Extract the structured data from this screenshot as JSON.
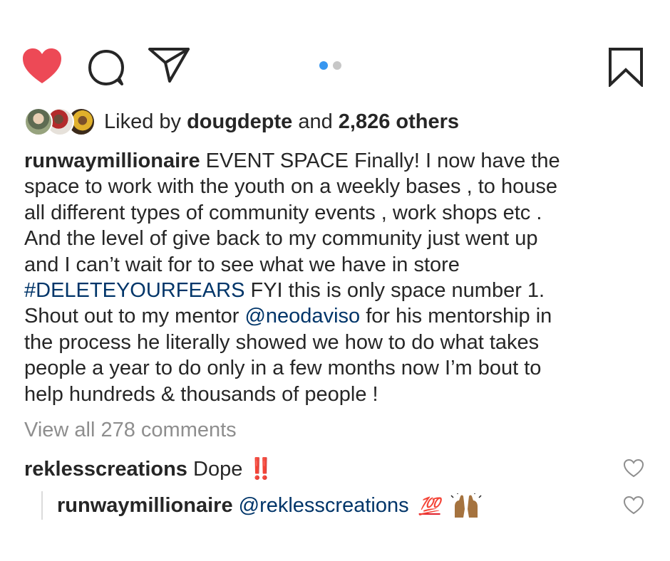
{
  "actions": {
    "like_icon": "heart-filled-icon",
    "comment_icon": "speech-bubble-icon",
    "share_icon": "paper-plane-icon",
    "save_icon": "bookmark-icon",
    "like_color": "#ed4956",
    "carousel": {
      "count": 2,
      "active_index": 0,
      "active_color": "#3897f0"
    }
  },
  "likes": {
    "prefix": "Liked by",
    "user": "dougdepte",
    "middle": "and",
    "count": "2,826 others"
  },
  "caption": {
    "username": "runwaymillionaire",
    "line1_text": " EVENT SPACE Finally! I now have the",
    "line2": "space to work with the youth on a weekly bases , to house",
    "line3": "all different types of community events , work shops etc .",
    "line4": "And the level of give back to my community just went up",
    "line5": "and I can’t wait for to see what we have in store",
    "hashtag": "#DELETEYOURFEARS",
    "line6_text": " FYI this is only space number 1.",
    "line7_pre": "Shout out to my mentor ",
    "mention": "@neodaviso",
    "line7_post": " for his mentorship in",
    "line8": "the process he literally showed we how to do what takes",
    "line9": "people a year to do only in a few months now I’m bout to",
    "line10": "help hundreds & thousands of people !"
  },
  "view_all_comments": "View all 278 comments",
  "comments": [
    {
      "username": "reklesscreations",
      "text": " Dope",
      "emoji": "‼️",
      "like_icon": "heart-outline-icon"
    },
    {
      "username": "runwaymillionaire",
      "mention": "@reklesscreations",
      "emoji1": "💯",
      "emoji2_icon": "raised-hands-icon",
      "like_icon": "heart-outline-icon"
    }
  ]
}
